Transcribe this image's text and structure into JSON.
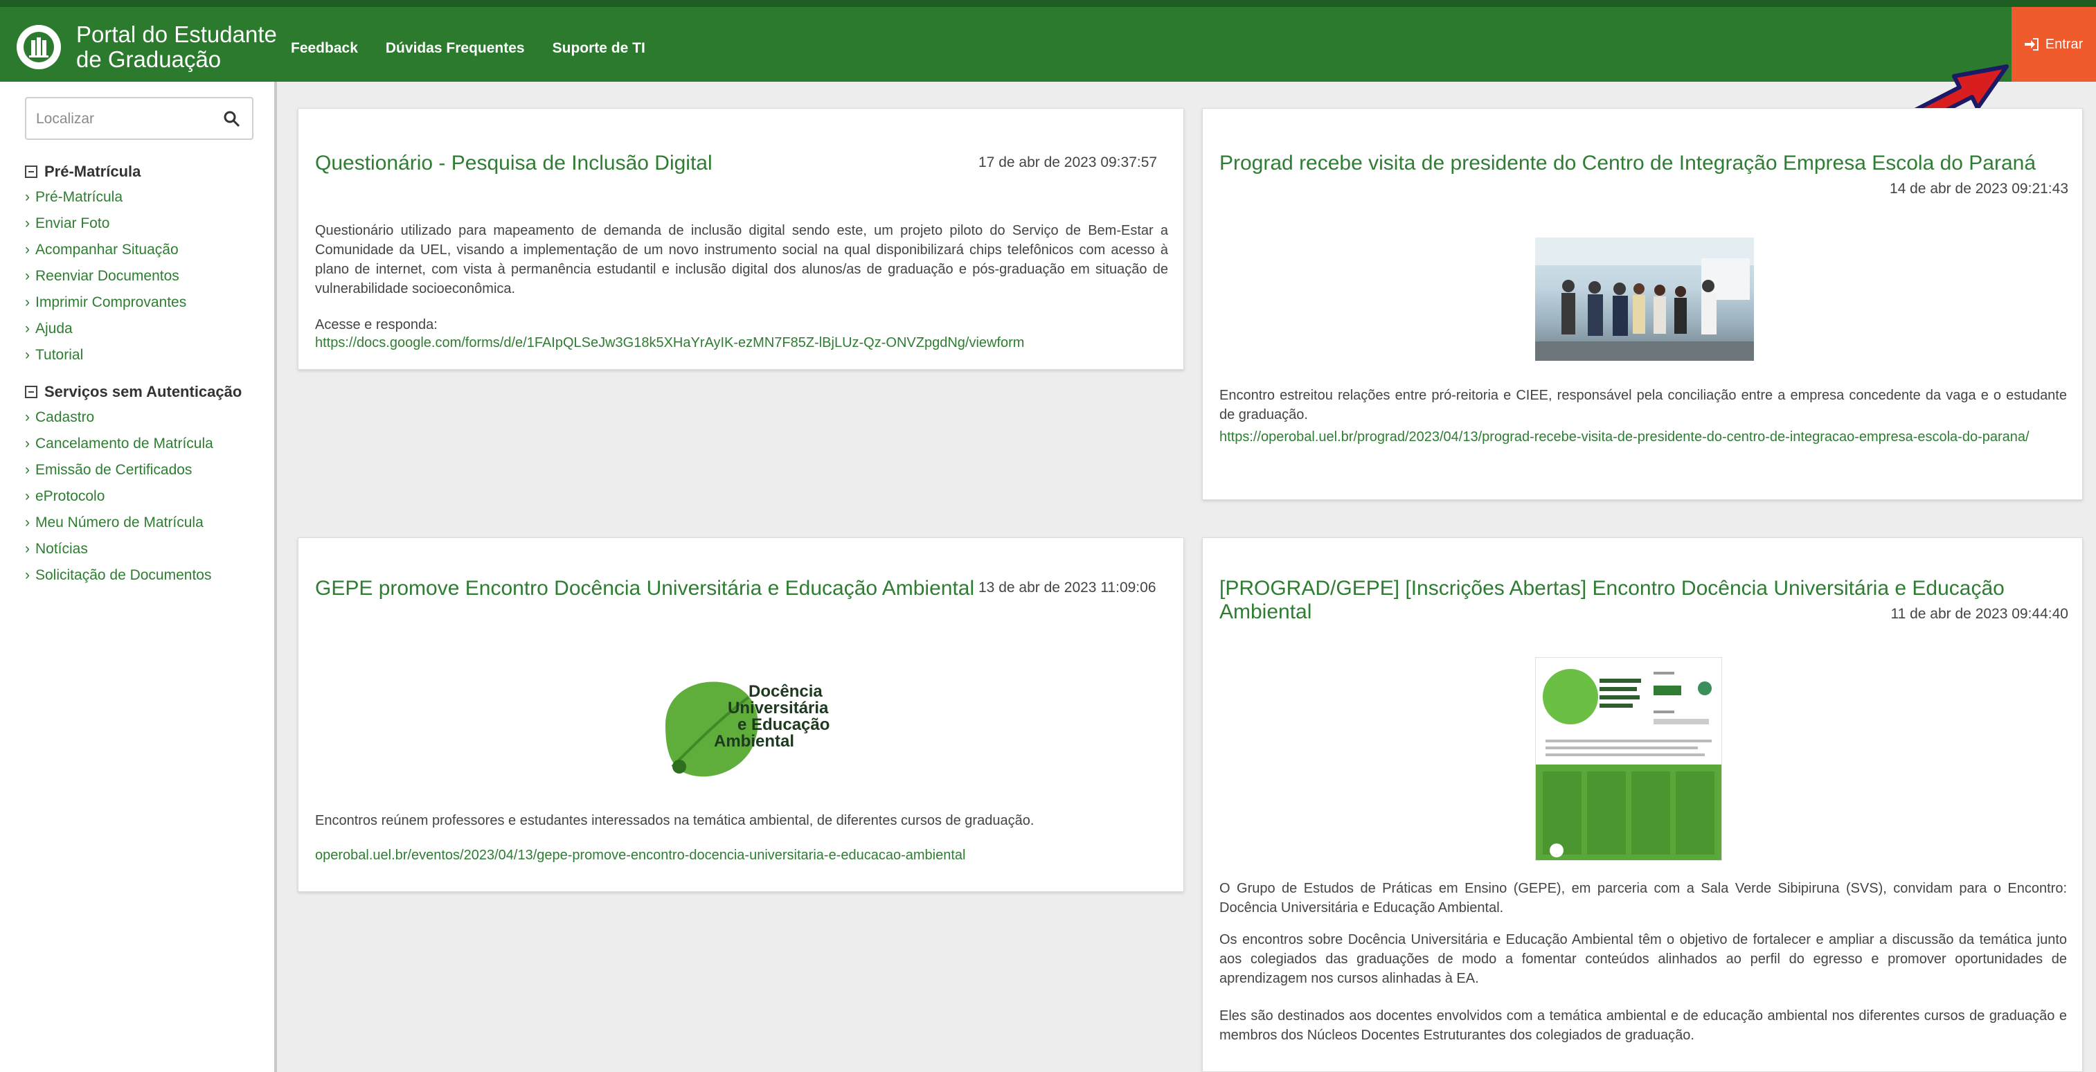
{
  "header": {
    "brand_line1": "Portal do Estudante",
    "brand_line2": "de Graduação",
    "nav": [
      "Feedback",
      "Dúvidas Frequentes",
      "Suporte de TI"
    ],
    "login_label": "Entrar",
    "brand_color": "#2c7a2e",
    "login_color": "#ef5b2c"
  },
  "sidebar": {
    "search_placeholder": "Localizar",
    "sections": [
      {
        "title": "Pré-Matrícula",
        "items": [
          "Pré-Matrícula",
          "Enviar Foto",
          "Acompanhar Situação",
          "Reenviar Documentos",
          "Imprimir Comprovantes",
          "Ajuda",
          "Tutorial"
        ]
      },
      {
        "title": "Serviços sem Autenticação",
        "items": [
          "Cadastro",
          "Cancelamento de Matrícula",
          "Emissão de Certificados",
          "eProtocolo",
          "Meu Número de Matrícula",
          "Notícias",
          "Solicitação de Documentos"
        ]
      }
    ]
  },
  "news": {
    "card1": {
      "title": "Questionário - Pesquisa de Inclusão Digital",
      "date": "17 de abr de 2023 09:37:57",
      "text": "Questionário utilizado para mapeamento de demanda de inclusão digital sendo este, um projeto piloto do Serviço de Bem-Estar a Comunidade da UEL, visando a implementação de um novo instrumento social na qual disponibilizará chips telefônicos com acesso à plano de internet, com vista à permanência estudantil e inclusão digital dos alunos/as de graduação e pós-graduação em situação de vulnerabilidade socioeconômica.",
      "access_label": "Acesse e responda:",
      "link": "https://docs.google.com/forms/d/e/1FAIpQLSeJw3G18k5XHaYrAyIK-ezMN7F85Z-lBjLUz-Qz-ONVZpgdNg/viewform"
    },
    "card2": {
      "title": "Prograd recebe visita de presidente do Centro de Integração Empresa Escola do Paraná",
      "date": "14 de abr de 2023 09:21:43",
      "text": "Encontro estreitou relações entre pró-reitoria e CIEE, responsável pela conciliação entre a empresa concedente da vaga e o estudante de graduação.",
      "link": "https://operobal.uel.br/prograd/2023/04/13/prograd-recebe-visita-de-presidente-do-centro-de-integracao-empresa-escola-do-parana/"
    },
    "card3": {
      "title": "GEPE promove Encontro Docência Universitária e Educação Ambiental",
      "date": "13 de abr de 2023 11:09:06",
      "logo_line1": "Docência",
      "logo_line2": "Universitária",
      "logo_line3": "e Educação",
      "logo_line4": "Ambiental",
      "text": "Encontros reúnem professores e estudantes interessados na temática ambiental, de diferentes cursos de graduação.",
      "link": "operobal.uel.br/eventos/2023/04/13/gepe-promove-encontro-docencia-universitaria-e-educacao-ambiental"
    },
    "card4": {
      "title": "[PROGRAD/GEPE] [Inscrições Abertas] Encontro Docência Universitária e Educação Ambiental",
      "date": "11 de abr de 2023 09:44:40",
      "p1": "O Grupo de Estudos de Práticas em Ensino (GEPE), em parceria com a Sala Verde Sibipiruna (SVS), convidam para o Encontro: Docência Universitária e Educação Ambiental.",
      "p2": "Os encontros sobre Docência Universitária e Educação Ambiental têm o objetivo de fortalecer e ampliar a discussão da temática junto aos colegiados das graduações de modo a fomentar conteúdos alinhados ao perfil do egresso e promover oportunidades de aprendizagem nos cursos alinhadas à EA.",
      "p3": "Eles são destinados aos docentes envolvidos com a temática ambiental e de educação ambiental nos diferentes cursos de graduação e membros dos Núcleos Docentes Estruturantes dos colegiados de graduação."
    }
  }
}
